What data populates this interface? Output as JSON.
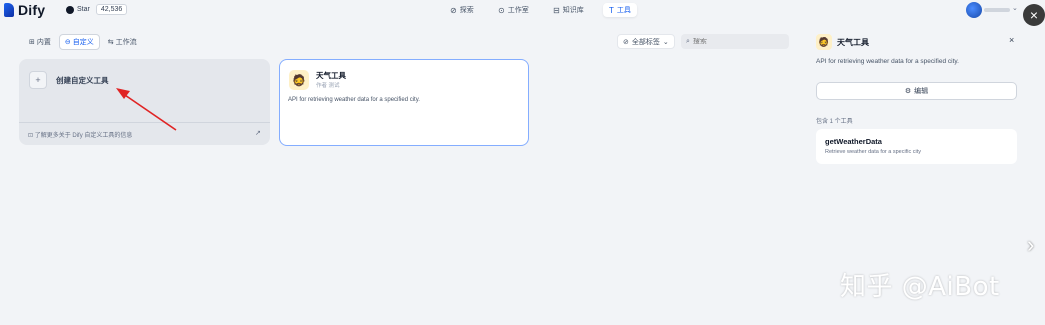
{
  "header": {
    "logo_text": "Dify",
    "github_label": "Star",
    "github_count": "42,536",
    "nav": [
      {
        "icon": "compass-icon",
        "glyph": "⊘",
        "label": "探索"
      },
      {
        "icon": "studio-icon",
        "glyph": "⊙",
        "label": "工作室"
      },
      {
        "icon": "knowledge-icon",
        "glyph": "⊟",
        "label": "知识库"
      },
      {
        "icon": "tools-icon",
        "glyph": "T",
        "label": "工具"
      }
    ]
  },
  "toolbar": {
    "tabs": [
      {
        "icon": "grid-icon",
        "glyph": "⊞",
        "label": "内置"
      },
      {
        "icon": "custom-icon",
        "glyph": "⊖",
        "label": "自定义"
      },
      {
        "icon": "workflow-icon",
        "glyph": "⇆",
        "label": "工作流"
      }
    ],
    "filter_label": "全部标签",
    "search_placeholder": "搜索"
  },
  "create_card": {
    "plus": "+",
    "label": "创建自定义工具",
    "footer": "⊡ 了解更多关于 Dify 自定义工具的信息",
    "footer_arrow": "↗"
  },
  "tool_card": {
    "icon": "🧔",
    "title": "天气工具",
    "author": "作者 测试",
    "description": "API for retrieving weather data for a specified city."
  },
  "panel": {
    "icon": "🧔",
    "title": "天气工具",
    "close": "×",
    "description": "API for retrieving weather data for a specified city.",
    "edit_icon": "⚙",
    "edit_label": "编辑",
    "contains_label": "包含 1 个工具",
    "items": [
      {
        "name": "getWeatherData",
        "description": "Retrieve weather data for a specific city"
      }
    ]
  },
  "overlay": {
    "close": "×",
    "next": "›",
    "watermark": "知乎 @AiBot"
  }
}
